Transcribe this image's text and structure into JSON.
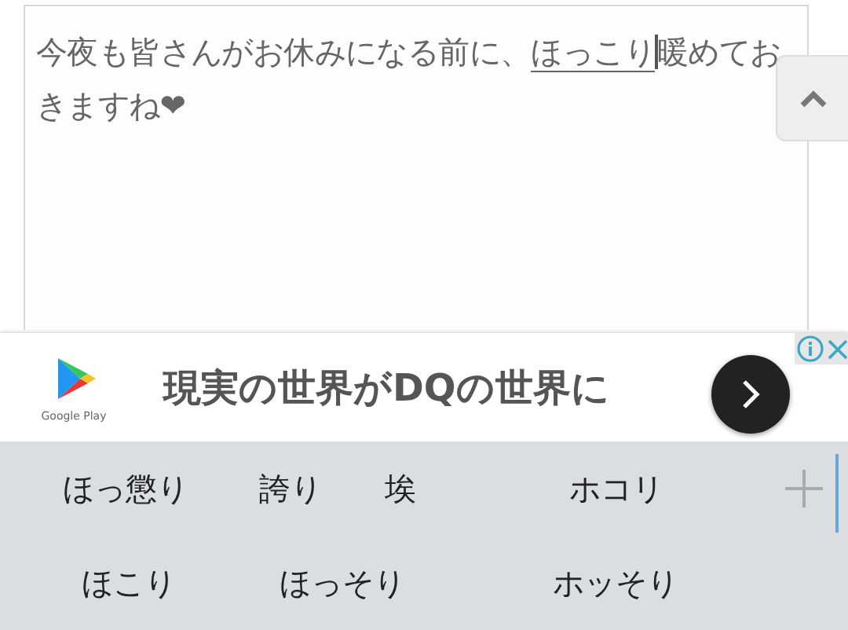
{
  "message": {
    "before": "今夜も皆さんがお休みになる前に、",
    "composing": "ほっこり",
    "after": "暖めておきますね❤"
  },
  "ad": {
    "store_label": "Google Play",
    "headline": "現実の世界がDQの世界に"
  },
  "suggestions": [
    [
      "ほっ懲り",
      "誇り",
      "埃",
      "ホコリ"
    ],
    [
      "ほこり",
      "ほっそり",
      "ホッそり"
    ]
  ]
}
